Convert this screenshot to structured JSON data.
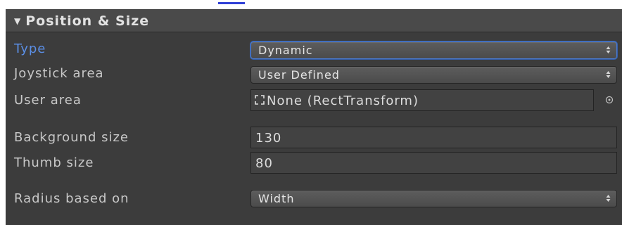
{
  "header": {
    "arrow": "▼",
    "title": "Position & Size"
  },
  "fields": {
    "type": {
      "label": "Type",
      "value": "Dynamic"
    },
    "joystick_area": {
      "label": "Joystick area",
      "value": "User Defined"
    },
    "user_area": {
      "label": "User area",
      "value": "None (RectTransform)"
    },
    "background_size": {
      "label": "Background size",
      "value": "130"
    },
    "thumb_size": {
      "label": "Thumb size",
      "value": "80"
    },
    "radius_based_on": {
      "label": "Radius based on",
      "value": "Width"
    }
  },
  "icons": {
    "header": "expand-triangle-icon",
    "dropdown": "dropdown-arrows-icon",
    "object": "rect-transform-icon",
    "picker": "object-picker-icon"
  },
  "colors": {
    "panel_bg": "#3c3c3c",
    "header_bg": "#4a4a4a",
    "label_text": "#c8c8c8",
    "active_label": "#5b8fe6",
    "focus_border": "#4a7bd2"
  }
}
